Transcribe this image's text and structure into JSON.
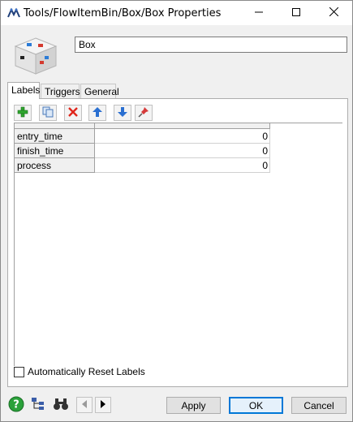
{
  "window": {
    "title": "Tools/FlowItemBin/Box/Box  Properties",
    "minimize_icon": "minimize-icon",
    "maximize_icon": "maximize-icon",
    "close_icon": "close-icon"
  },
  "object": {
    "icon": "box-object-icon",
    "name_value": "Box"
  },
  "tabs": [
    {
      "label": "Labels",
      "active": true
    },
    {
      "label": "Triggers",
      "active": false
    },
    {
      "label": "General",
      "active": false
    }
  ],
  "toolbar": {
    "buttons": [
      "add-label-icon",
      "copy-label-icon",
      "delete-label-icon",
      "move-up-icon",
      "move-down-icon",
      "pin-icon"
    ]
  },
  "labels_table": {
    "rows": [
      {
        "name": "entry_time",
        "value": "0"
      },
      {
        "name": "finish_time",
        "value": "0"
      },
      {
        "name": "process",
        "value": "0"
      }
    ]
  },
  "auto_reset": {
    "label": "Automatically Reset Labels",
    "checked": false
  },
  "footer": {
    "help_icon": "help-icon",
    "tree_icon": "tree-view-icon",
    "find_icon": "binoculars-icon",
    "prev_icon": "arrow-left-icon",
    "next_icon": "arrow-right-icon",
    "apply_label": "Apply",
    "ok_label": "OK",
    "cancel_label": "Cancel"
  }
}
